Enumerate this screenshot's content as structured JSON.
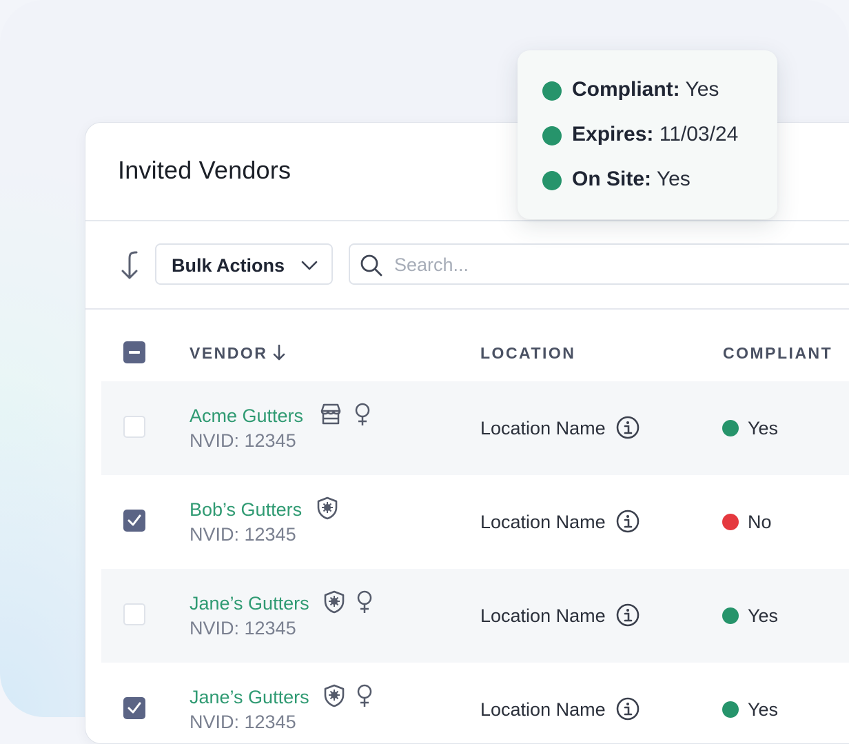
{
  "page": {
    "title": "Invited Vendors"
  },
  "toolbar": {
    "bulk_actions_label": "Bulk Actions",
    "search_placeholder": "Search...",
    "search_value": ""
  },
  "table": {
    "columns": {
      "vendor": "VENDOR",
      "location": "LOCATION",
      "compliant": "COMPLIANT"
    },
    "sort": {
      "column": "vendor",
      "direction": "descending"
    },
    "header_checkbox": "indeterminate",
    "rows": [
      {
        "vendor": "Acme Gutters",
        "nvid": "NVID: 12345",
        "icons": [
          "storefront-icon",
          "female-owned-icon"
        ],
        "location": "Location Name",
        "compliant": "Yes",
        "checked": false
      },
      {
        "vendor": "Bob’s Gutters",
        "nvid": "NVID: 12345",
        "icons": [
          "shield-badge-icon"
        ],
        "location": "Location Name",
        "compliant": "No",
        "checked": true
      },
      {
        "vendor": "Jane’s Gutters",
        "nvid": "NVID: 12345",
        "icons": [
          "shield-badge-icon",
          "female-owned-icon"
        ],
        "location": "Location Name",
        "compliant": "Yes",
        "checked": false
      },
      {
        "vendor": "Jane’s Gutters",
        "nvid": "NVID: 12345",
        "icons": [
          "shield-badge-icon",
          "female-owned-icon"
        ],
        "location": "Location Name",
        "compliant": "Yes",
        "checked": true
      }
    ]
  },
  "tooltip": {
    "items": [
      {
        "label": "Compliant:",
        "value": "Yes"
      },
      {
        "label": "Expires:",
        "value": "11/03/24"
      },
      {
        "label": "On Site:",
        "value": "Yes"
      }
    ]
  },
  "colors": {
    "accent_green": "#2f9a72",
    "status_yes": "#26946b",
    "status_no": "#e5393f",
    "checkbox_fill": "#5b6485"
  }
}
